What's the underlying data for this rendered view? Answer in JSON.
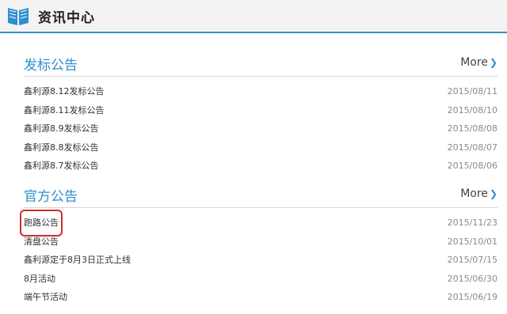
{
  "header": {
    "title": "资讯中心",
    "icon": "book-icon"
  },
  "sections": [
    {
      "title": "发标公告",
      "more_label": "More",
      "items": [
        {
          "title": "鑫利源8.12发标公告",
          "date": "2015/08/11"
        },
        {
          "title": "鑫利源8.11发标公告",
          "date": "2015/08/10"
        },
        {
          "title": "鑫利源8.9发标公告",
          "date": "2015/08/08"
        },
        {
          "title": "鑫利源8.8发标公告",
          "date": "2015/08/07"
        },
        {
          "title": "鑫利源8.7发标公告",
          "date": "2015/08/06"
        }
      ]
    },
    {
      "title": "官方公告",
      "more_label": "More",
      "items": [
        {
          "title": "跑路公告",
          "date": "2015/11/23"
        },
        {
          "title": "清盘公告",
          "date": "2015/10/01"
        },
        {
          "title": "鑫利源定于8月3日正式上线",
          "date": "2015/07/15"
        },
        {
          "title": "8月活动",
          "date": "2015/06/30"
        },
        {
          "title": "端午节活动",
          "date": "2015/06/19"
        }
      ]
    }
  ],
  "colors": {
    "accent": "#2d8fd0",
    "highlight_box": "#d42b2b"
  }
}
